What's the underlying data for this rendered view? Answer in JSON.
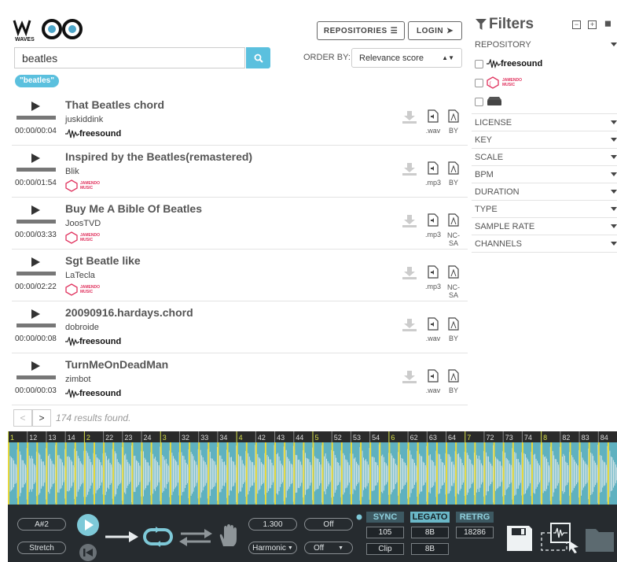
{
  "header": {
    "repositories_label": "REPOSITORIES",
    "login_label": "LOGIN"
  },
  "search": {
    "value": "beatles",
    "order_label": "ORDER BY:",
    "order_value": "Relevance score",
    "tag": "\"beatles\""
  },
  "results": [
    {
      "title": "That Beatles chord",
      "user": "juskiddink",
      "time": "00:00/00:04",
      "source": "freesound",
      "format": ".wav",
      "license": "BY"
    },
    {
      "title": "Inspired by the Beatles(remastered)",
      "user": "Blik",
      "time": "00:00/01:54",
      "source": "jamendo",
      "format": ".mp3",
      "license": "BY"
    },
    {
      "title": "Buy Me A Bible Of Beatles",
      "user": "JoosTVD",
      "time": "00:00/03:33",
      "source": "jamendo",
      "format": ".mp3",
      "license": "NC-SA"
    },
    {
      "title": "Sgt Beatle like",
      "user": "LaTecla",
      "time": "00:00/02:22",
      "source": "jamendo",
      "format": ".mp3",
      "license": "NC-SA"
    },
    {
      "title": "20090916.hardays.chord",
      "user": "dobroide",
      "time": "00:00/00:08",
      "source": "freesound",
      "format": ".wav",
      "license": "BY"
    },
    {
      "title": "TurnMeOnDeadMan",
      "user": "zimbot",
      "time": "00:00/00:03",
      "source": "freesound",
      "format": ".wav",
      "license": "BY"
    }
  ],
  "pagination": {
    "prev": "<",
    "next": ">",
    "found": "174 results found."
  },
  "filters": {
    "title": "Filters",
    "repository_label": "REPOSITORY",
    "repos": [
      "freesound",
      "JAMENDO MUSIC",
      "drive"
    ],
    "sections": [
      "LICENSE",
      "KEY",
      "SCALE",
      "BPM",
      "DURATION",
      "TYPE",
      "SAMPLE RATE",
      "CHANNELS"
    ]
  },
  "ruler": [
    "1",
    "12",
    "13",
    "14",
    "2",
    "22",
    "23",
    "24",
    "3",
    "32",
    "33",
    "34",
    "4",
    "42",
    "43",
    "44",
    "5",
    "52",
    "53",
    "54",
    "6",
    "62",
    "63",
    "64",
    "7",
    "72",
    "73",
    "74",
    "8",
    "82",
    "83",
    "84"
  ],
  "controls": {
    "key": "A#2",
    "mode": "Stretch",
    "rate": "1.300",
    "harmonic": "Harmonic",
    "off1": "Off",
    "off2": "Off",
    "sync": "SYNC",
    "legato": "LEGATO",
    "retrig": "RETRG",
    "bpm": "105",
    "beats1": "8B",
    "samples": "18286",
    "clip": "Clip",
    "beats2": "8B"
  },
  "icons": [
    "play-icon",
    "download-icon",
    "audio-file-icon",
    "license-icon",
    "search-icon",
    "filter-icon",
    "waves-logo-icon",
    "hand-icon",
    "loop-icon",
    "arrow-right-icon",
    "save-icon"
  ]
}
